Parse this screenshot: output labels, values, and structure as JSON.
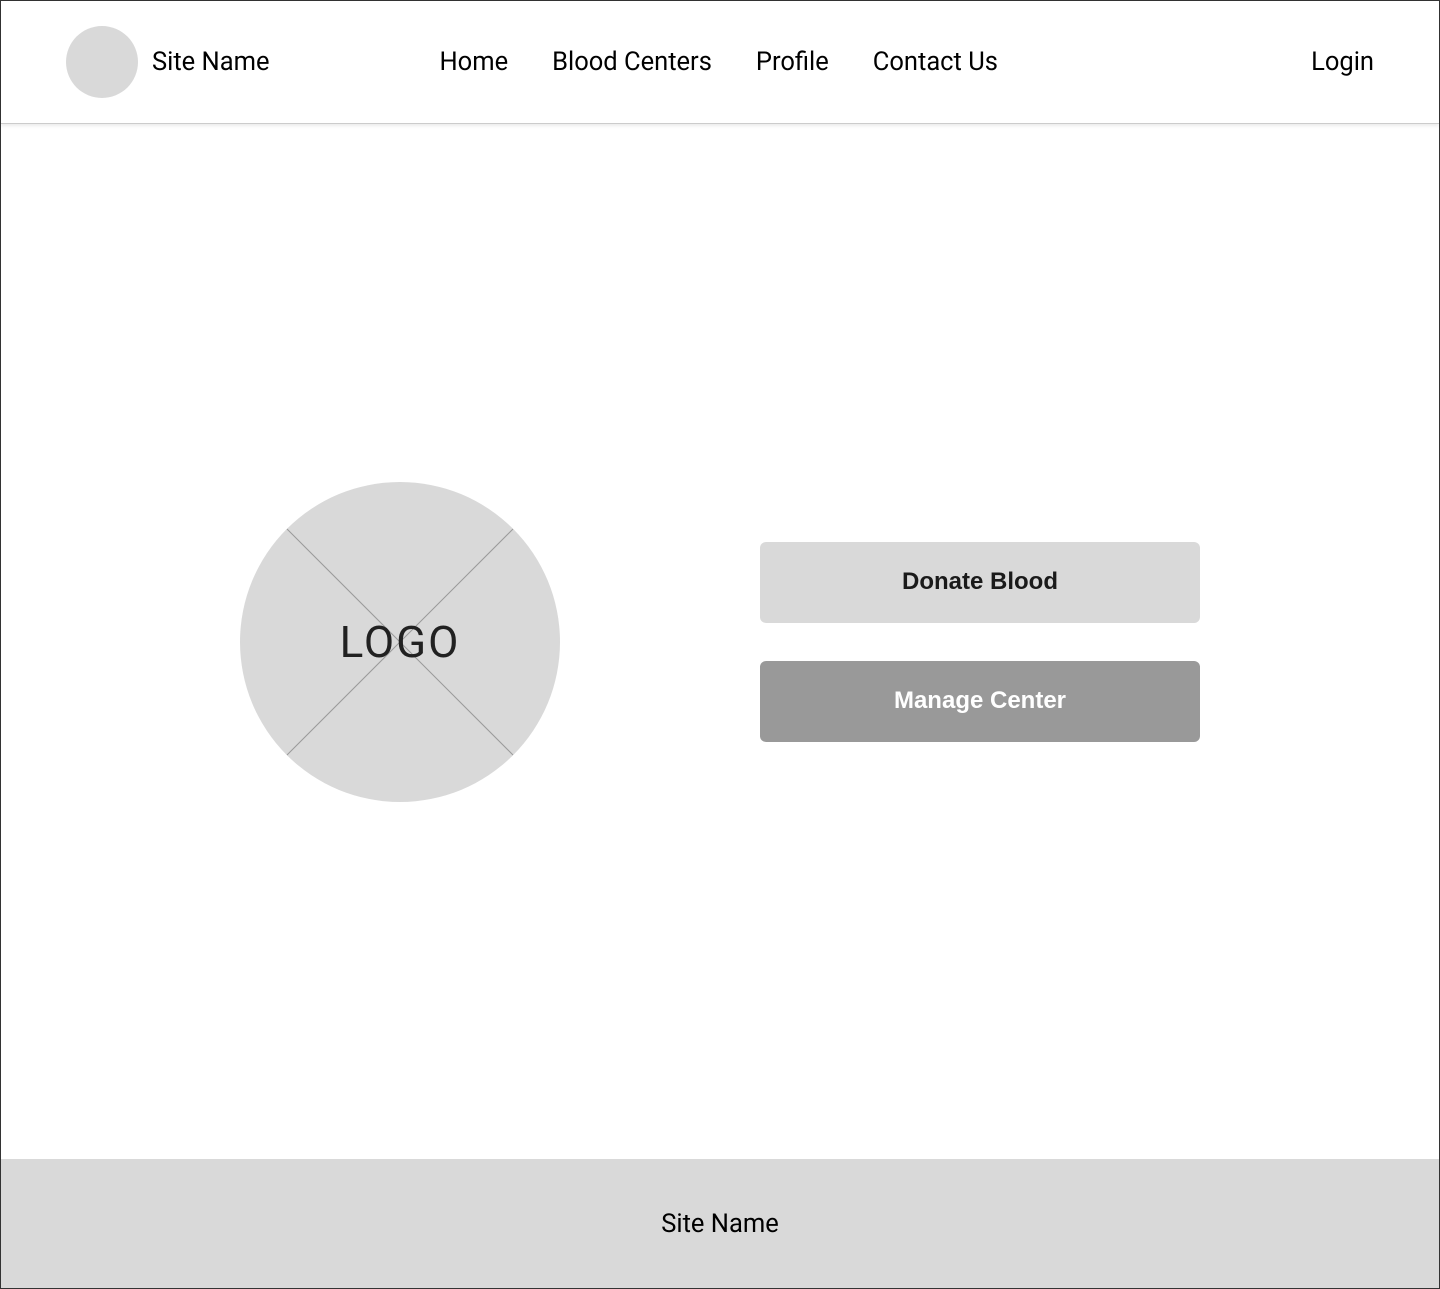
{
  "header": {
    "site_name": "Site Name",
    "nav": [
      {
        "label": "Home"
      },
      {
        "label": "Blood Centers"
      },
      {
        "label": "Profile"
      },
      {
        "label": "Contact Us"
      }
    ],
    "login_label": "Login"
  },
  "main": {
    "logo_placeholder_label": "LOGO",
    "cta": {
      "donate_label": "Donate Blood",
      "manage_label": "Manage Center"
    }
  },
  "footer": {
    "site_name": "Site Name"
  }
}
